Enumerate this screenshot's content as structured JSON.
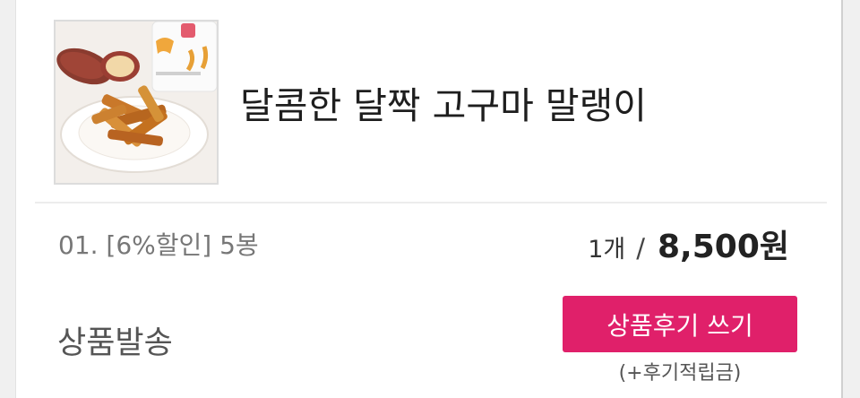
{
  "product": {
    "name": "달콤한 달짝 고구마 말랭이",
    "image_alt": "sweet potato snack photo"
  },
  "order": {
    "option": "01. [6%할인] 5봉",
    "quantity": "1개",
    "separator": "/",
    "price": "8,500원"
  },
  "status": {
    "label": "상품발송"
  },
  "review": {
    "button_label": "상품후기 쓰기",
    "reward_note": "(+후기적립금)"
  },
  "colors": {
    "accent": "#e0206a"
  }
}
